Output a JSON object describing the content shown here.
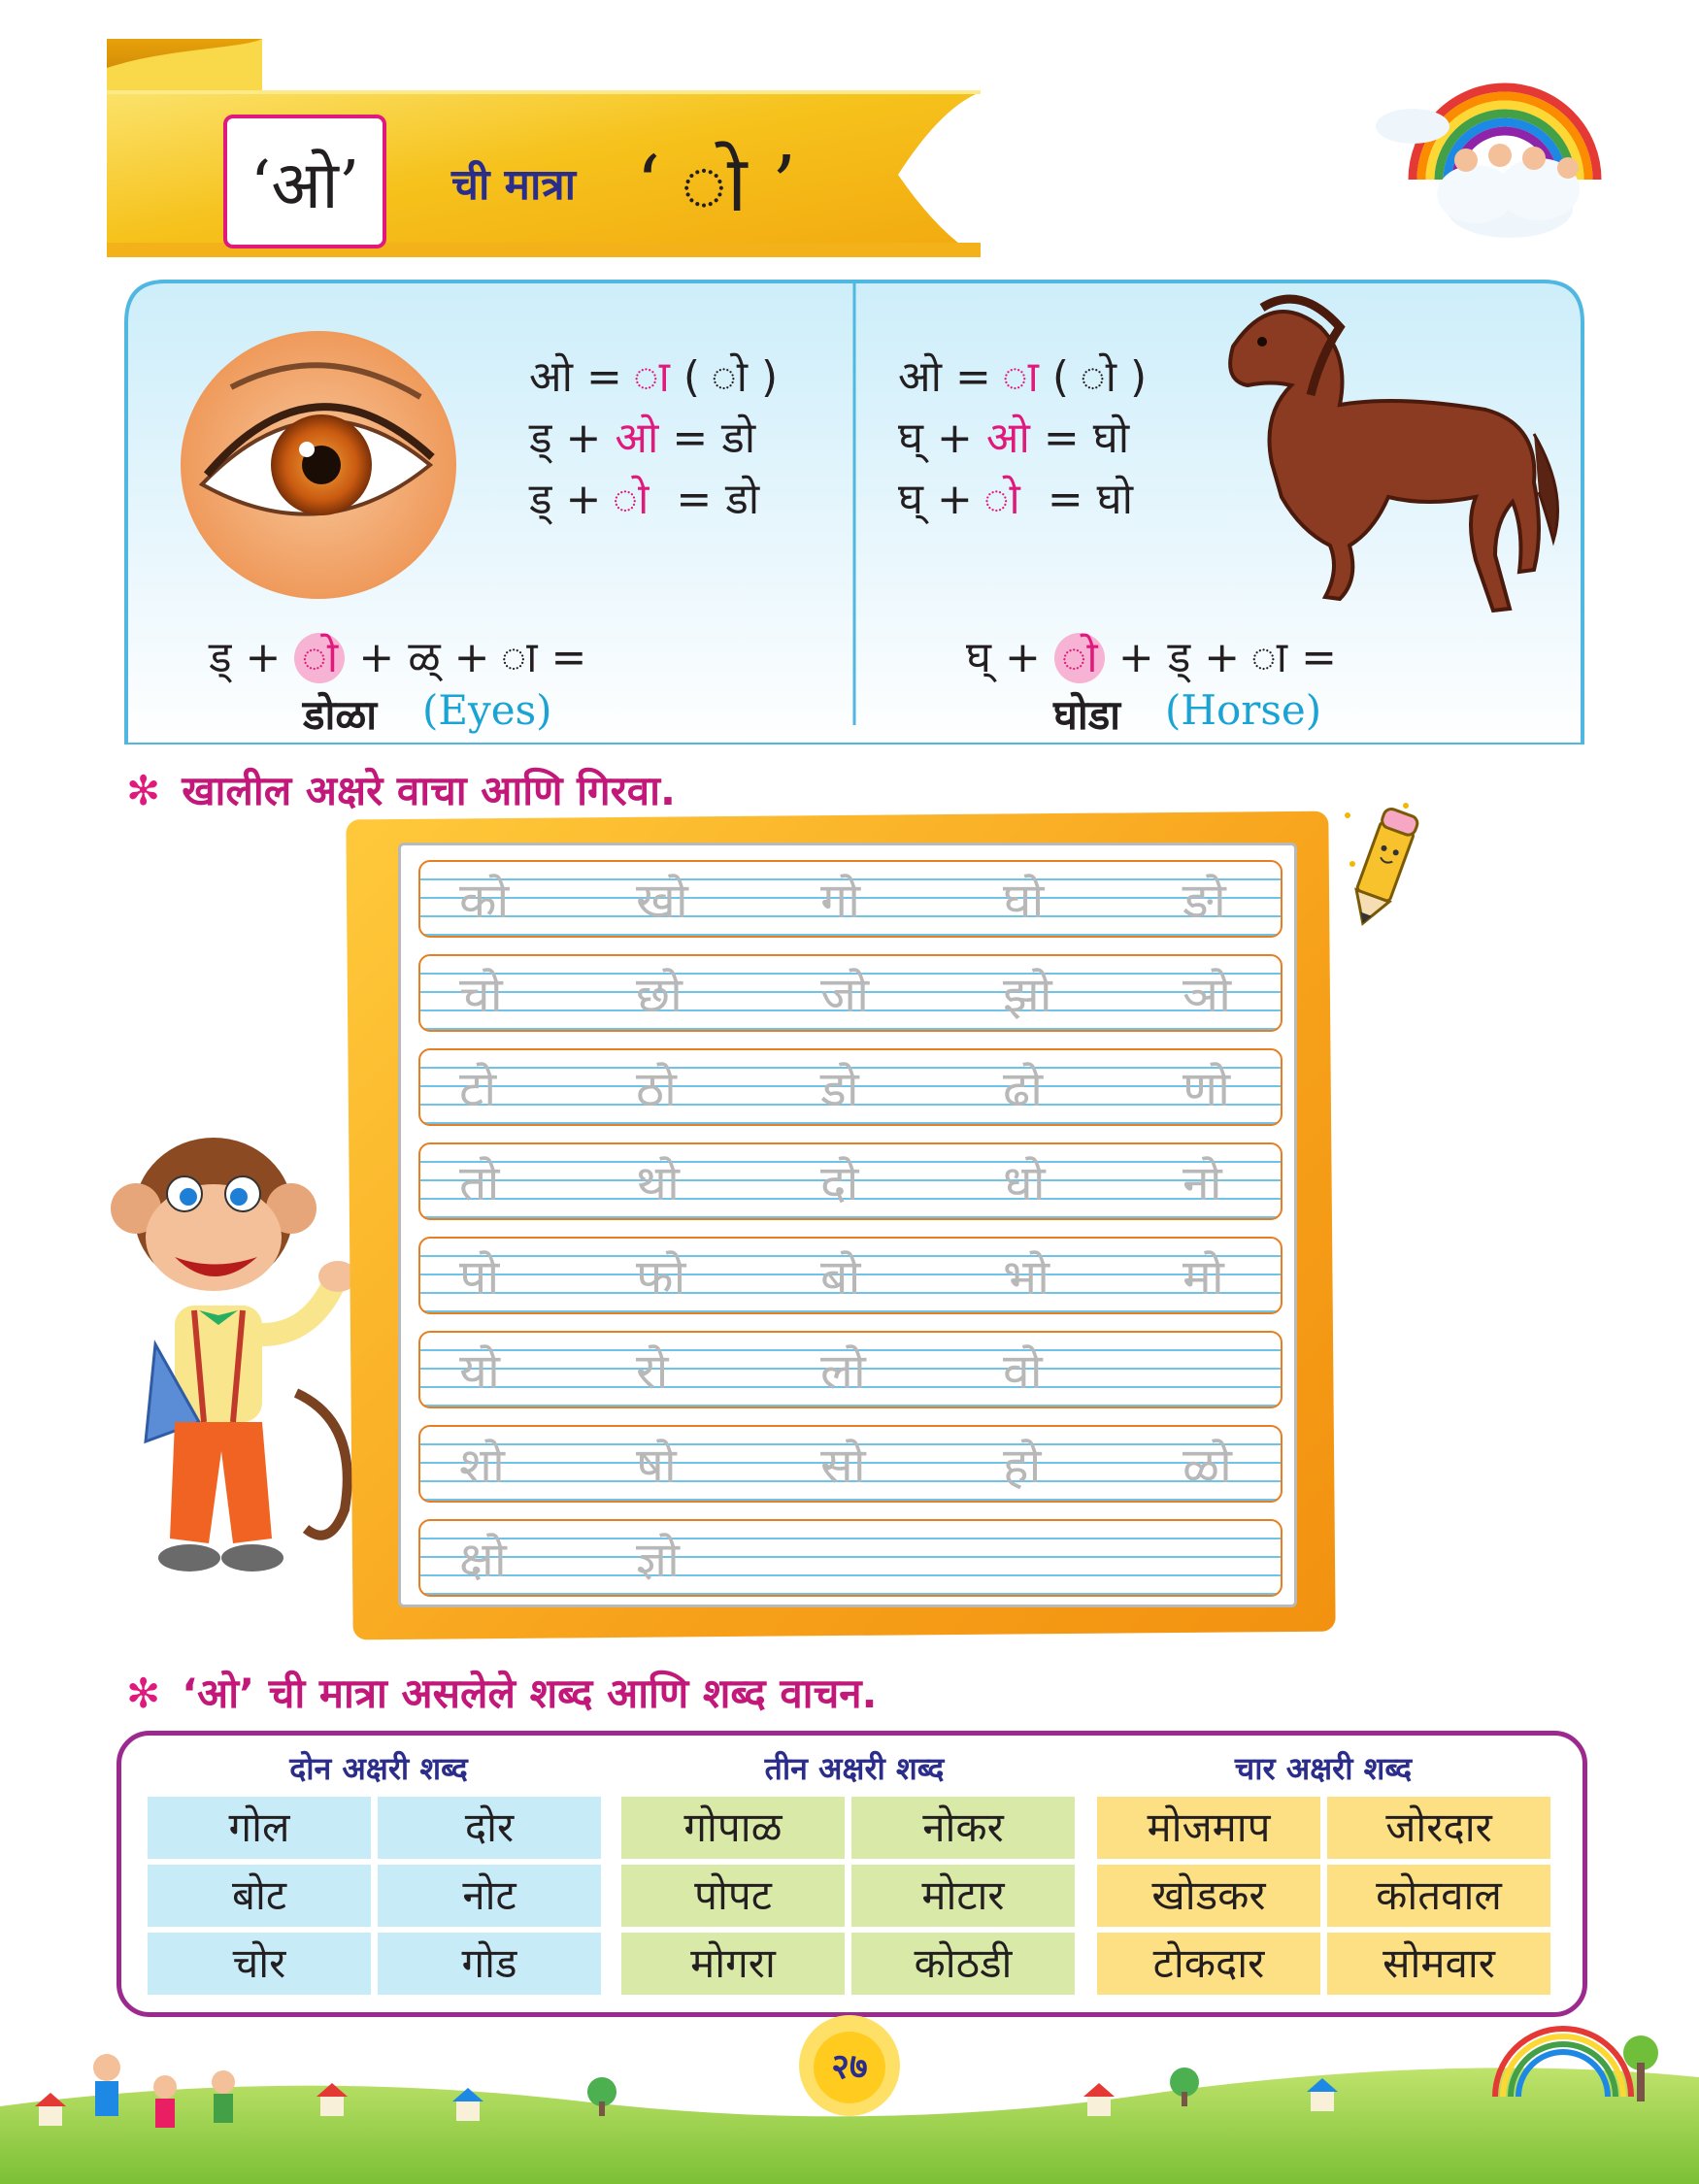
{
  "banner": {
    "letter": "‘ओ’",
    "text": "ची मात्रा",
    "sign": "‘ ो ’"
  },
  "left_example": {
    "lines": [
      [
        "ओ =",
        " ा",
        " ( ो )"
      ],
      [
        "ड् +",
        " ओ",
        " = डो"
      ],
      [
        "ड् +",
        " ो",
        "  = डो"
      ]
    ],
    "bottom_pre": "ड् +",
    "bottom_mark": "ो",
    "bottom_post": "+ ळ् + ा =",
    "word": "डोळा",
    "english": "(Eyes)"
  },
  "right_example": {
    "lines": [
      [
        "ओ =",
        " ा",
        " ( ो )"
      ],
      [
        "घ् +",
        " ओ",
        " = घो"
      ],
      [
        "घ् +",
        " ो",
        "  = घो"
      ]
    ],
    "bottom_pre": "घ् +",
    "bottom_mark": "ो",
    "bottom_post": "+ ड् + ा =",
    "word": "घोडा",
    "english": "(Horse)"
  },
  "practice_heading": {
    "star": "✻",
    "text": "खालील अक्षरे वाचा आणि गिरवा."
  },
  "practice_rows": [
    [
      "को",
      "खो",
      "गो",
      "घो",
      "ङो"
    ],
    [
      "चो",
      "छो",
      "जो",
      "झो",
      "ञो"
    ],
    [
      "टो",
      "ठो",
      "डो",
      "ढो",
      "णो"
    ],
    [
      "तो",
      "थो",
      "दो",
      "धो",
      "नो"
    ],
    [
      "पो",
      "फो",
      "बो",
      "भो",
      "मो"
    ],
    [
      "यो",
      "रो",
      "लो",
      "वो",
      ""
    ],
    [
      "शो",
      "षो",
      "सो",
      "हो",
      "ळो"
    ],
    [
      "क्षो",
      "ज्ञो",
      "",
      "",
      ""
    ]
  ],
  "words_heading": {
    "star": "✻",
    "text": "‘ओ’ ची मात्रा असलेले शब्द आणि शब्द वाचन."
  },
  "word_groups": [
    {
      "title": "दोन अक्षरी शब्द",
      "color": "#c8ebf8",
      "words": [
        "गोल",
        "दोर",
        "बोट",
        "नोट",
        "चोर",
        "गोड"
      ]
    },
    {
      "title": "तीन अक्षरी शब्द",
      "color": "#d9eaa8",
      "words": [
        "गोपाळ",
        "नोकर",
        "पोपट",
        "मोटार",
        "मोगरा",
        "कोठडी"
      ]
    },
    {
      "title": "चार अक्षरी शब्द",
      "color": "#fde083",
      "words": [
        "मोजमाप",
        "जोरदार",
        "खोडकर",
        "कोतवाल",
        "टोकदार",
        "सोमवार"
      ]
    }
  ],
  "page_number": "२७",
  "colors": {
    "pink": "#e0197d",
    "navy": "#2b2d8a",
    "magenta_heading": "#c2187a",
    "panel_blue": "#dff3fb",
    "english_blue": "#1ba3d4"
  }
}
